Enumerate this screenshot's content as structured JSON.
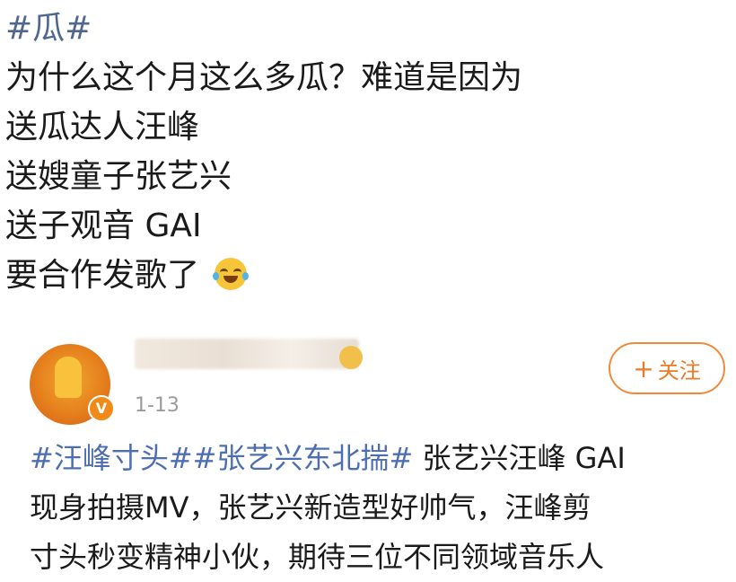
{
  "post": {
    "hashtag": "#瓜#",
    "lines": [
      "为什么这个月这么多瓜？难道是因为",
      "送瓜达人汪峰",
      "送嫂童子张艺兴",
      "送子观音 GAI",
      "要合作发歌了"
    ],
    "emoji": "laughing-crying-emoji"
  },
  "card": {
    "username": "████████",
    "date": "1-13",
    "follow_plus": "+",
    "follow_label": "关注",
    "badge": "V",
    "hashtag1": "#汪峰寸头#",
    "hashtag2": "#张艺兴东北揣#",
    "line1_text": " 张艺兴汪峰 GAI",
    "line2": "现身拍摄MV，张艺兴新造型好帅气，汪峰剪",
    "line3": "寸头秒变精神小伙，期待三位不同领域音乐人"
  },
  "colors": {
    "hashtag": "#50678f",
    "follow_accent": "#ec7b29",
    "badge": "#f08b1a"
  }
}
